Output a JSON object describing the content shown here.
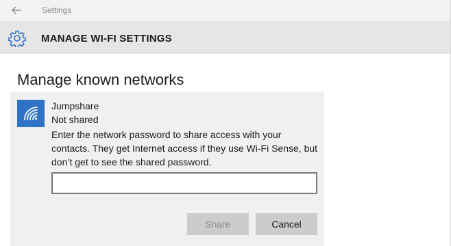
{
  "titlebar": {
    "title": "Settings",
    "back_icon": "back-arrow-icon"
  },
  "header": {
    "icon": "gear-icon",
    "title": "MANAGE WI-FI SETTINGS"
  },
  "page": {
    "title": "Manage known networks"
  },
  "network": {
    "icon": "wifi-icon",
    "name": "Jumpshare",
    "status": "Not shared",
    "description": "Enter the network password to share access with your contacts. They get Internet access if they use Wi-Fi Sense, but don’t get to see the shared password.",
    "password_value": "",
    "share_label": "Share",
    "cancel_label": "Cancel"
  },
  "colors": {
    "accent": "#2f73c8",
    "header_bg": "#e6e6e6",
    "panel_bg": "#f0f0f0",
    "button_bg": "#cccccc"
  }
}
